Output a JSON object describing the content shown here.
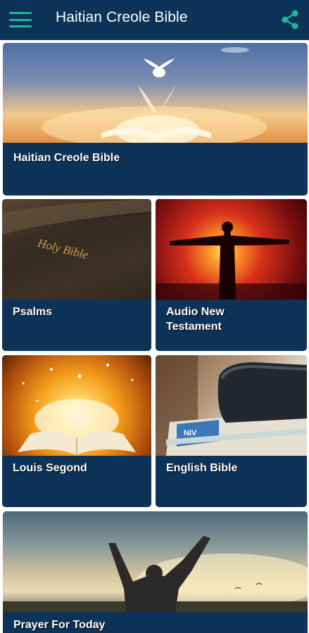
{
  "app_bar": {
    "title": "Haitian Creole Bible",
    "menu_icon": "hamburger-menu-icon",
    "share_icon": "share-icon",
    "background_color": "#0d3358",
    "accent_color": "#1fb59a"
  },
  "cards": [
    {
      "label": "Haitian Creole Bible",
      "image": "dove-over-open-bible-sunrise"
    },
    {
      "label": "Psalms",
      "image": "holy-bible-cover-closeup"
    },
    {
      "label": "Audio New Testament",
      "image": "christ-statue-silhouette-red-sunset"
    },
    {
      "label": "Louis Segond",
      "image": "glowing-open-book"
    },
    {
      "label": "English Bible",
      "image": "stacked-bibles"
    },
    {
      "label": "Prayer For Today",
      "image": "person-raising-arms-at-sunset"
    }
  ]
}
